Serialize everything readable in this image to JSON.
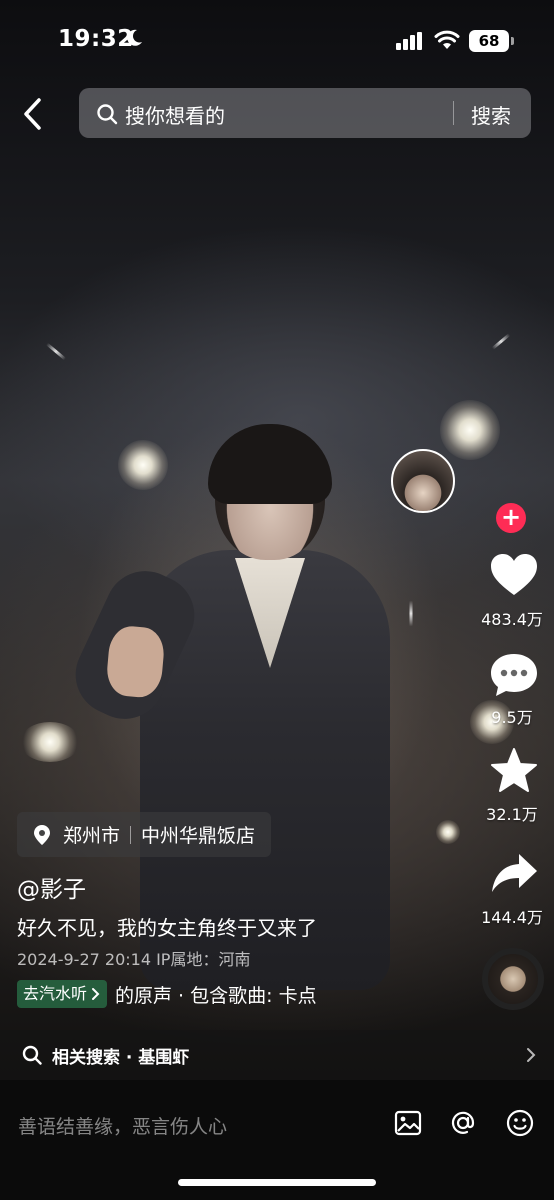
{
  "status_bar": {
    "time": "19:32",
    "battery": "68"
  },
  "search": {
    "placeholder": "搜你想看的",
    "button_label": "搜索"
  },
  "rail": {
    "likes": "483.4万",
    "comments": "9.5万",
    "favorites": "32.1万",
    "shares": "144.4万",
    "follow_symbol": "+"
  },
  "post": {
    "location_city": "郑州市",
    "location_place": "中州华鼎饭店",
    "author": "@影子",
    "description": "好久不见，我的女主角终于又来了",
    "meta": "2024-9-27 20:14  IP属地：河南",
    "music_pill": "去汽水听",
    "music_text": "的原声 · 包含歌曲: 卡点"
  },
  "related": {
    "label": "相关搜索 · 基围虾"
  },
  "comment_bar": {
    "placeholder": "善语结善缘，恶言伤人心"
  },
  "colors": {
    "follow": "#fe2c55",
    "music_pill": "#2a7a4c"
  }
}
